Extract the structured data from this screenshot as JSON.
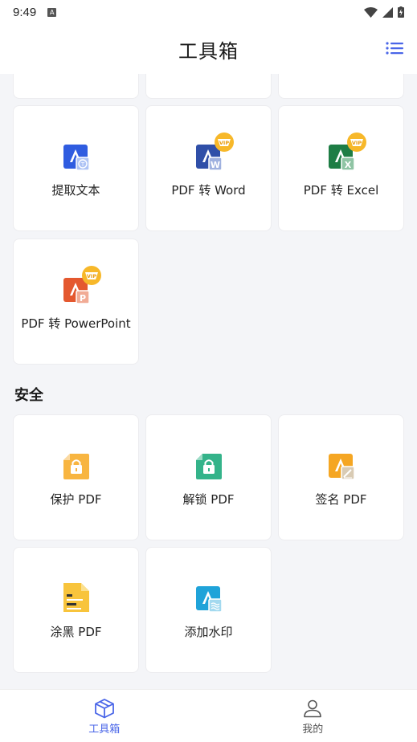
{
  "status_bar": {
    "time": "9:49",
    "indicator": "A"
  },
  "app_bar": {
    "title": "工具箱",
    "menu_icon": "list-icon"
  },
  "colors": {
    "accent": "#4a66e8",
    "vip": "#f7b82a"
  },
  "convert_tools": [
    {
      "label": "提取文本",
      "icon": "extract-text-icon",
      "vip": false
    },
    {
      "label": "PDF 转 Word",
      "icon": "pdf-to-word-icon",
      "vip": true
    },
    {
      "label": "PDF 转 Excel",
      "icon": "pdf-to-excel-icon",
      "vip": true
    },
    {
      "label": "PDF 转 PowerPoint",
      "icon": "pdf-to-ppt-icon",
      "vip": true
    }
  ],
  "security_section": {
    "title": "安全",
    "tools": [
      {
        "label": "保护 PDF",
        "icon": "protect-pdf-icon"
      },
      {
        "label": "解锁 PDF",
        "icon": "unlock-pdf-icon"
      },
      {
        "label": "签名 PDF",
        "icon": "sign-pdf-icon"
      },
      {
        "label": "涂黑 PDF",
        "icon": "redact-pdf-icon"
      },
      {
        "label": "添加水印",
        "icon": "watermark-icon"
      }
    ]
  },
  "vip_badge": "VIP",
  "bottom_nav": [
    {
      "label": "工具箱",
      "icon": "toolbox-icon",
      "active": true
    },
    {
      "label": "我的",
      "icon": "profile-icon",
      "active": false
    }
  ]
}
